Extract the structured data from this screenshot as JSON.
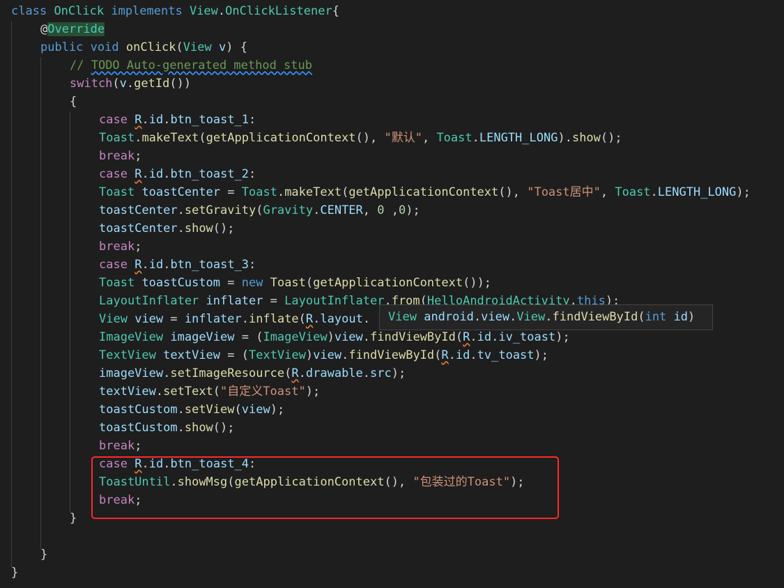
{
  "lines": [
    {
      "tokens": [
        {
          "t": "class",
          "c": "kw"
        },
        {
          "t": " ",
          "c": "plain"
        },
        {
          "t": "OnClick",
          "c": "type"
        },
        {
          "t": " ",
          "c": "plain"
        },
        {
          "t": "implements",
          "c": "kw"
        },
        {
          "t": " ",
          "c": "plain"
        },
        {
          "t": "View",
          "c": "type"
        },
        {
          "t": ".",
          "c": "plain"
        },
        {
          "t": "OnClickListener",
          "c": "type"
        },
        {
          "t": "{",
          "c": "plain"
        }
      ]
    },
    {
      "tokens": [
        {
          "t": "@",
          "c": "at"
        },
        {
          "t": "Override",
          "c": "anno"
        }
      ]
    },
    {
      "tokens": [
        {
          "t": "public",
          "c": "kw"
        },
        {
          "t": " ",
          "c": "plain"
        },
        {
          "t": "void",
          "c": "kw"
        },
        {
          "t": " ",
          "c": "plain"
        },
        {
          "t": "onClick",
          "c": "fn"
        },
        {
          "t": "(",
          "c": "plain"
        },
        {
          "t": "View",
          "c": "type"
        },
        {
          "t": " ",
          "c": "plain"
        },
        {
          "t": "v",
          "c": "var"
        },
        {
          "t": ") {",
          "c": "plain"
        }
      ]
    },
    {
      "tokens": [
        {
          "t": "// ",
          "c": "com"
        },
        {
          "t": "TODO Auto-generated method stub",
          "c": "com",
          "u": "blue"
        }
      ]
    },
    {
      "tokens": [
        {
          "t": "switch",
          "c": "ctl"
        },
        {
          "t": "(",
          "c": "plain"
        },
        {
          "t": "v",
          "c": "var"
        },
        {
          "t": ".",
          "c": "plain"
        },
        {
          "t": "getId",
          "c": "fn"
        },
        {
          "t": "())",
          "c": "plain"
        }
      ]
    },
    {
      "tokens": [
        {
          "t": "{",
          "c": "plain"
        }
      ]
    },
    {
      "tokens": [
        {
          "t": "case",
          "c": "ctl"
        },
        {
          "t": " ",
          "c": "plain"
        },
        {
          "t": "R",
          "c": "var",
          "u": "orange"
        },
        {
          "t": ".",
          "c": "plain"
        },
        {
          "t": "id",
          "c": "var"
        },
        {
          "t": ".",
          "c": "plain"
        },
        {
          "t": "btn_toast_1",
          "c": "var"
        },
        {
          "t": ":",
          "c": "plain"
        }
      ]
    },
    {
      "tokens": [
        {
          "t": "Toast",
          "c": "type"
        },
        {
          "t": ".",
          "c": "plain"
        },
        {
          "t": "makeText",
          "c": "fn"
        },
        {
          "t": "(",
          "c": "plain"
        },
        {
          "t": "getApplicationContext",
          "c": "fn"
        },
        {
          "t": "(), ",
          "c": "plain"
        },
        {
          "t": "\"默认\"",
          "c": "str"
        },
        {
          "t": ", ",
          "c": "plain"
        },
        {
          "t": "Toast",
          "c": "type"
        },
        {
          "t": ".",
          "c": "plain"
        },
        {
          "t": "LENGTH_LONG",
          "c": "var"
        },
        {
          "t": ").",
          "c": "plain"
        },
        {
          "t": "show",
          "c": "fn"
        },
        {
          "t": "();",
          "c": "plain"
        }
      ]
    },
    {
      "tokens": [
        {
          "t": "break",
          "c": "ctl"
        },
        {
          "t": ";",
          "c": "plain"
        }
      ]
    },
    {
      "tokens": [
        {
          "t": "case",
          "c": "ctl"
        },
        {
          "t": " ",
          "c": "plain"
        },
        {
          "t": "R",
          "c": "var",
          "u": "orange"
        },
        {
          "t": ".",
          "c": "plain"
        },
        {
          "t": "id",
          "c": "var"
        },
        {
          "t": ".",
          "c": "plain"
        },
        {
          "t": "btn_toast_2",
          "c": "var"
        },
        {
          "t": ":",
          "c": "plain"
        }
      ]
    },
    {
      "tokens": [
        {
          "t": "Toast",
          "c": "type"
        },
        {
          "t": " ",
          "c": "plain"
        },
        {
          "t": "toastCenter",
          "c": "var"
        },
        {
          "t": " = ",
          "c": "plain"
        },
        {
          "t": "Toast",
          "c": "type"
        },
        {
          "t": ".",
          "c": "plain"
        },
        {
          "t": "makeText",
          "c": "fn"
        },
        {
          "t": "(",
          "c": "plain"
        },
        {
          "t": "getApplicationContext",
          "c": "fn"
        },
        {
          "t": "(), ",
          "c": "plain"
        },
        {
          "t": "\"Toast居中\"",
          "c": "str"
        },
        {
          "t": ", ",
          "c": "plain"
        },
        {
          "t": "Toast",
          "c": "type"
        },
        {
          "t": ".",
          "c": "plain"
        },
        {
          "t": "LENGTH_LONG",
          "c": "var"
        },
        {
          "t": ");",
          "c": "plain"
        }
      ]
    },
    {
      "tokens": [
        {
          "t": "toastCenter",
          "c": "var"
        },
        {
          "t": ".",
          "c": "plain"
        },
        {
          "t": "setGravity",
          "c": "fn"
        },
        {
          "t": "(",
          "c": "plain"
        },
        {
          "t": "Gravity",
          "c": "type"
        },
        {
          "t": ".",
          "c": "plain"
        },
        {
          "t": "CENTER",
          "c": "var"
        },
        {
          "t": ", ",
          "c": "plain"
        },
        {
          "t": "0",
          "c": "num"
        },
        {
          "t": " ,",
          "c": "plain"
        },
        {
          "t": "0",
          "c": "num"
        },
        {
          "t": ");",
          "c": "plain"
        }
      ]
    },
    {
      "tokens": [
        {
          "t": "toastCenter",
          "c": "var"
        },
        {
          "t": ".",
          "c": "plain"
        },
        {
          "t": "show",
          "c": "fn"
        },
        {
          "t": "();",
          "c": "plain"
        }
      ]
    },
    {
      "tokens": [
        {
          "t": "break",
          "c": "ctl"
        },
        {
          "t": ";",
          "c": "plain"
        }
      ]
    },
    {
      "tokens": [
        {
          "t": "case",
          "c": "ctl"
        },
        {
          "t": " ",
          "c": "plain"
        },
        {
          "t": "R",
          "c": "var",
          "u": "orange"
        },
        {
          "t": ".",
          "c": "plain"
        },
        {
          "t": "id",
          "c": "var"
        },
        {
          "t": ".",
          "c": "plain"
        },
        {
          "t": "btn_toast_3",
          "c": "var"
        },
        {
          "t": ":",
          "c": "plain"
        }
      ]
    },
    {
      "tokens": [
        {
          "t": "Toast",
          "c": "type"
        },
        {
          "t": " ",
          "c": "plain"
        },
        {
          "t": "toastCustom",
          "c": "var"
        },
        {
          "t": " = ",
          "c": "plain"
        },
        {
          "t": "new",
          "c": "kw"
        },
        {
          "t": " ",
          "c": "plain"
        },
        {
          "t": "Toast",
          "c": "fn"
        },
        {
          "t": "(",
          "c": "plain"
        },
        {
          "t": "getApplicationContext",
          "c": "fn"
        },
        {
          "t": "());",
          "c": "plain"
        }
      ]
    },
    {
      "tokens": [
        {
          "t": "LayoutInflater",
          "c": "type"
        },
        {
          "t": " ",
          "c": "plain"
        },
        {
          "t": "inflater",
          "c": "var"
        },
        {
          "t": " = ",
          "c": "plain"
        },
        {
          "t": "LayoutInflater",
          "c": "type"
        },
        {
          "t": ".",
          "c": "plain"
        },
        {
          "t": "from",
          "c": "fn"
        },
        {
          "t": "(",
          "c": "plain"
        },
        {
          "t": "HelloAndroidActivity",
          "c": "type"
        },
        {
          "t": ".",
          "c": "plain"
        },
        {
          "t": "this",
          "c": "kw"
        },
        {
          "t": ");",
          "c": "plain"
        }
      ]
    },
    {
      "tokens": [
        {
          "t": "View",
          "c": "type"
        },
        {
          "t": " ",
          "c": "plain"
        },
        {
          "t": "view",
          "c": "var"
        },
        {
          "t": " = ",
          "c": "plain"
        },
        {
          "t": "inflater",
          "c": "var"
        },
        {
          "t": ".",
          "c": "plain"
        },
        {
          "t": "inflate",
          "c": "fn"
        },
        {
          "t": "(",
          "c": "plain"
        },
        {
          "t": "R",
          "c": "var",
          "u": "orange"
        },
        {
          "t": ".",
          "c": "plain"
        },
        {
          "t": "layout",
          "c": "var"
        },
        {
          "t": ".",
          "c": "plain"
        }
      ]
    },
    {
      "tokens": [
        {
          "t": "ImageView",
          "c": "type"
        },
        {
          "t": " ",
          "c": "plain"
        },
        {
          "t": "imageView",
          "c": "var"
        },
        {
          "t": " = (",
          "c": "plain"
        },
        {
          "t": "ImageView",
          "c": "type"
        },
        {
          "t": ")",
          "c": "plain"
        },
        {
          "t": "view",
          "c": "var"
        },
        {
          "t": ".",
          "c": "plain"
        },
        {
          "t": "findViewById",
          "c": "fn"
        },
        {
          "t": "(",
          "c": "plain"
        },
        {
          "t": "R",
          "c": "var",
          "u": "orange"
        },
        {
          "t": ".",
          "c": "plain"
        },
        {
          "t": "id",
          "c": "var"
        },
        {
          "t": ".",
          "c": "plain"
        },
        {
          "t": "iv_toast",
          "c": "var"
        },
        {
          "t": ");",
          "c": "plain"
        }
      ]
    },
    {
      "tokens": [
        {
          "t": "TextView",
          "c": "type"
        },
        {
          "t": " ",
          "c": "plain"
        },
        {
          "t": "textView",
          "c": "var"
        },
        {
          "t": " = (",
          "c": "plain"
        },
        {
          "t": "TextView",
          "c": "type"
        },
        {
          "t": ")",
          "c": "plain"
        },
        {
          "t": "view",
          "c": "var"
        },
        {
          "t": ".",
          "c": "plain"
        },
        {
          "t": "findViewById",
          "c": "fn"
        },
        {
          "t": "(",
          "c": "plain"
        },
        {
          "t": "R",
          "c": "var",
          "u": "orange"
        },
        {
          "t": ".",
          "c": "plain"
        },
        {
          "t": "id",
          "c": "var"
        },
        {
          "t": ".",
          "c": "plain"
        },
        {
          "t": "tv_toast",
          "c": "var"
        },
        {
          "t": ");",
          "c": "plain"
        }
      ]
    },
    {
      "tokens": [
        {
          "t": "imageView",
          "c": "var"
        },
        {
          "t": ".",
          "c": "plain"
        },
        {
          "t": "setImageResource",
          "c": "fn"
        },
        {
          "t": "(",
          "c": "plain"
        },
        {
          "t": "R",
          "c": "var",
          "u": "orange"
        },
        {
          "t": ".",
          "c": "plain"
        },
        {
          "t": "drawable",
          "c": "var"
        },
        {
          "t": ".",
          "c": "plain"
        },
        {
          "t": "src",
          "c": "var"
        },
        {
          "t": ");",
          "c": "plain"
        }
      ]
    },
    {
      "tokens": [
        {
          "t": "textView",
          "c": "var"
        },
        {
          "t": ".",
          "c": "plain"
        },
        {
          "t": "setText",
          "c": "fn"
        },
        {
          "t": "(",
          "c": "plain"
        },
        {
          "t": "\"自定义Toast\"",
          "c": "str"
        },
        {
          "t": ");",
          "c": "plain"
        }
      ]
    },
    {
      "tokens": [
        {
          "t": "toastCustom",
          "c": "var"
        },
        {
          "t": ".",
          "c": "plain"
        },
        {
          "t": "setView",
          "c": "fn"
        },
        {
          "t": "(",
          "c": "plain"
        },
        {
          "t": "view",
          "c": "var"
        },
        {
          "t": ");",
          "c": "plain"
        }
      ]
    },
    {
      "tokens": [
        {
          "t": "toastCustom",
          "c": "var"
        },
        {
          "t": ".",
          "c": "plain"
        },
        {
          "t": "show",
          "c": "fn"
        },
        {
          "t": "();",
          "c": "plain"
        }
      ]
    },
    {
      "tokens": [
        {
          "t": "break",
          "c": "ctl"
        },
        {
          "t": ";",
          "c": "plain"
        }
      ]
    },
    {
      "tokens": [
        {
          "t": "case",
          "c": "ctl"
        },
        {
          "t": " ",
          "c": "plain"
        },
        {
          "t": "R",
          "c": "var",
          "u": "orange"
        },
        {
          "t": ".",
          "c": "plain"
        },
        {
          "t": "id",
          "c": "var"
        },
        {
          "t": ".",
          "c": "plain"
        },
        {
          "t": "btn_toast_4",
          "c": "var"
        },
        {
          "t": ":",
          "c": "plain"
        }
      ]
    },
    {
      "tokens": [
        {
          "t": "ToastUntil",
          "c": "type"
        },
        {
          "t": ".",
          "c": "plain"
        },
        {
          "t": "showMsg",
          "c": "fn"
        },
        {
          "t": "(",
          "c": "plain"
        },
        {
          "t": "getApplicationContext",
          "c": "fn"
        },
        {
          "t": "(), ",
          "c": "plain"
        },
        {
          "t": "\"包装过的Toast\"",
          "c": "str"
        },
        {
          "t": ");",
          "c": "plain"
        }
      ]
    },
    {
      "tokens": [
        {
          "t": "break",
          "c": "ctl"
        },
        {
          "t": ";",
          "c": "plain"
        }
      ]
    },
    {
      "tokens": [
        {
          "t": "}",
          "c": "plain"
        }
      ]
    },
    {
      "tokens": []
    },
    {
      "tokens": [
        {
          "t": "}",
          "c": "plain"
        }
      ]
    },
    {
      "tokens": [
        {
          "t": "}",
          "c": "plain"
        }
      ]
    }
  ],
  "tooltip": {
    "tokens": [
      {
        "t": "View",
        "c": "type"
      },
      {
        "t": " ",
        "c": "plain"
      },
      {
        "t": "android",
        "c": "var"
      },
      {
        "t": ".",
        "c": "plain"
      },
      {
        "t": "view",
        "c": "var"
      },
      {
        "t": ".",
        "c": "plain"
      },
      {
        "t": "View",
        "c": "type"
      },
      {
        "t": ".",
        "c": "plain"
      },
      {
        "t": "findViewById",
        "c": "fn"
      },
      {
        "t": "(",
        "c": "plain"
      },
      {
        "t": "int",
        "c": "kw"
      },
      {
        "t": " ",
        "c": "plain"
      },
      {
        "t": "id",
        "c": "var"
      },
      {
        "t": ")",
        "c": "plain"
      }
    ]
  },
  "colors": {
    "background": "#1e1e1e",
    "highlight_border": "#ff2a2a",
    "tooltip_background": "#252526"
  }
}
